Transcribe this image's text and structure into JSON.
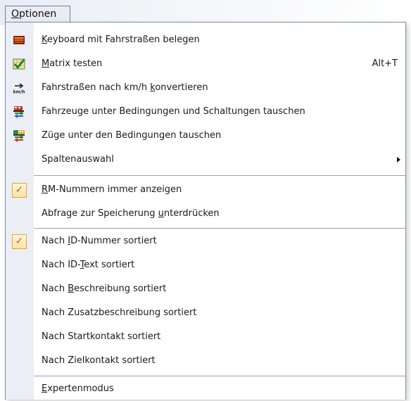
{
  "menubar": {
    "options_label": "Optionen",
    "options_mnemonic": "O",
    "options_rest": "ptionen"
  },
  "menu": {
    "items": [
      {
        "pre": "",
        "mn": "K",
        "post": "eyboard mit Fahrstraßen belegen",
        "icon": "keyboard-icon"
      },
      {
        "pre": "",
        "mn": "M",
        "post": "atrix testen",
        "shortcut": "Alt+T",
        "icon": "matrix-test-icon"
      },
      {
        "pre": "Fahrstraßen nach km/h ",
        "mn": "k",
        "post": "onvertieren",
        "icon": "kmh-icon"
      },
      {
        "pre": "Fahrzeuge unter Bedingungen und Schaltungen tauschen",
        "mn": "",
        "post": "",
        "icon": "swap-vehicles-icon"
      },
      {
        "pre": "Züge unter den Bedingungen tauschen",
        "mn": "",
        "post": "",
        "icon": "swap-trains-icon"
      },
      {
        "pre": "Spaltenauswahl",
        "mn": "",
        "post": "",
        "submenu": true
      },
      {
        "pre": "",
        "mn": "R",
        "post": "M-Nummern immer anzeigen",
        "checked": true
      },
      {
        "pre": "Abfrage zur Speicherung ",
        "mn": "u",
        "post": "nterdrücken"
      },
      {
        "pre": "Nach ",
        "mn": "I",
        "post": "D-Nummer sortiert",
        "checked": true
      },
      {
        "pre": "Nach ID-",
        "mn": "T",
        "post": "ext sortiert"
      },
      {
        "pre": "Nach ",
        "mn": "B",
        "post": "eschreibung sortiert"
      },
      {
        "pre": "Nach Zusatzbeschreibung sortiert",
        "mn": "",
        "post": ""
      },
      {
        "pre": "Nach Startkontakt sortiert",
        "mn": "",
        "post": ""
      },
      {
        "pre": "Nach Zielkontakt sortiert",
        "mn": "",
        "post": ""
      },
      {
        "pre": "",
        "mn": "E",
        "post": "xpertenmodus"
      }
    ],
    "checkmark": "✓"
  }
}
